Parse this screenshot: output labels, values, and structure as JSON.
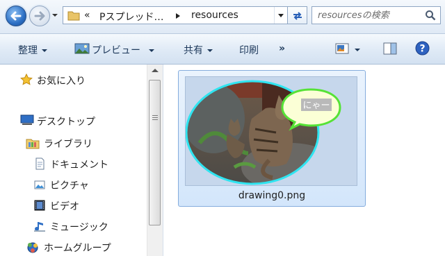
{
  "address": {
    "prefix": "«",
    "parent": "Pスプレッド…",
    "current": "resources"
  },
  "search": {
    "placeholder": "resourcesの検索"
  },
  "toolbar": {
    "organize": "整理",
    "preview": "プレビュー",
    "share": "共有",
    "print": "印刷",
    "more": "»"
  },
  "nav": {
    "favorites": "お気に入り",
    "desktop": "デスクトップ",
    "libraries": "ライブラリ",
    "documents": "ドキュメント",
    "pictures": "ピクチャ",
    "videos": "ビデオ",
    "music": "ミュージック",
    "homegroup": "ホームグループ"
  },
  "files": [
    {
      "name": "drawing0.png",
      "bubble_text": "にゃー"
    }
  ]
}
